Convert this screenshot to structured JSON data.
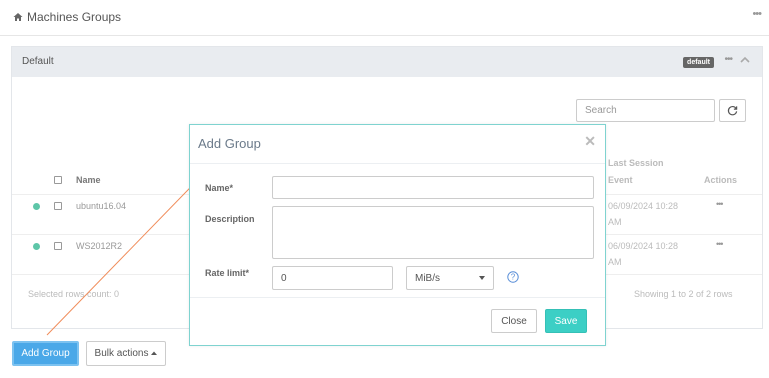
{
  "page": {
    "title": "Machines Groups",
    "menu": "•••"
  },
  "panel": {
    "title": "Default",
    "badge": "default",
    "menu": "•••",
    "search_placeholder": "Search"
  },
  "table": {
    "headers": {
      "name": "Name",
      "last_session": "Last Session Event",
      "actions": "Actions"
    },
    "rows": [
      {
        "name": "ubuntu16.04",
        "date": "06/09/2024 10:28",
        "time_suffix": "AM",
        "actions": "•••"
      },
      {
        "name": "WS2012R2",
        "date": "06/09/2024 10:28",
        "time_suffix": "AM",
        "actions": "•••"
      }
    ],
    "selected_count": "Selected rows count: 0",
    "showing": "Showing 1 to 2 of 2 rows"
  },
  "buttons": {
    "add_group": "Add Group",
    "bulk_actions": "Bulk actions"
  },
  "modal": {
    "title": "Add Group",
    "close_glyph": "✕",
    "labels": {
      "name": "Name*",
      "description": "Description",
      "rate_limit": "Rate limit*"
    },
    "values": {
      "name": "",
      "description": "",
      "rate_limit": "0",
      "unit": "MiB/s"
    },
    "close_button": "Close",
    "save_button": "Save"
  },
  "colors": {
    "accent": "#3ccfc5",
    "primary": "#4aa8e8",
    "status_online": "#5ec6a8",
    "annotation_arrow": "#f08c5a"
  }
}
